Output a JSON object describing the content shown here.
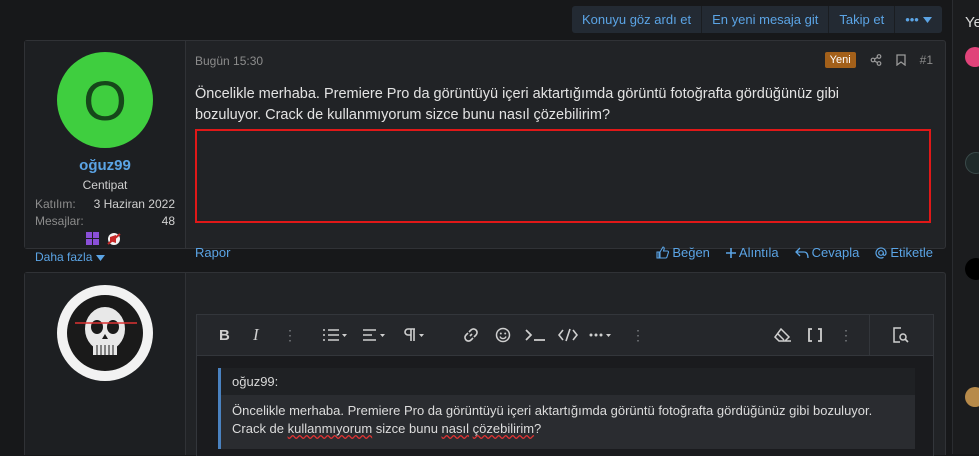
{
  "topbar": {
    "ignore_label": "Konuyu göz ardı et",
    "newest_label": "En yeni mesaja git",
    "follow_label": "Takip et",
    "more_label": "•••"
  },
  "sidebar_right": {
    "title_fragment": "Ye"
  },
  "post": {
    "avatar_letter": "O",
    "username": "oğuz99",
    "user_title": "Centipat",
    "joined_label": "Katılım:",
    "joined_value": "3 Haziran 2022",
    "messages_label": "Mesajlar:",
    "messages_value": "48",
    "more_label": "Daha fazla",
    "time": "Bugün 15:30",
    "new_badge": "Yeni",
    "post_number": "#1",
    "body_line1": "Öncelikle merhaba. Premiere Pro da görüntüyü içeri aktartığımda görüntü fotoğrafta gördüğünüz gibi",
    "body_line2": "bozuluyor. Crack de kullanmıyorum sizce bunu nasıl çözebilirim?",
    "report_label": "Rapor",
    "like_label": "Beğen",
    "quote_label": "Alıntıla",
    "reply_label": "Cevapla",
    "tag_label": "Etiketle"
  },
  "editor": {
    "quote_author": "oğuz99:",
    "quote_line1": "Öncelikle merhaba. Premiere Pro da görüntüyü içeri aktartığımda görüntü fotoğrafta gördüğünüz gibi bozuluyor.",
    "quote_line2_pre": "Crack de ",
    "quote_line2_w1": "kullanmıyorum",
    "quote_line2_mid": " sizce bunu ",
    "quote_line2_w2": "nasıl",
    "quote_line2_w3": "çözebilirim",
    "quote_line2_end": "?"
  },
  "colors": {
    "accent": "#5ba4e5",
    "avatar_bg": "#3fce3f",
    "new_badge": "#a3601a",
    "highlight_box": "#e01818"
  },
  "icons": [
    "share-icon",
    "bookmark-icon",
    "like-icon",
    "plus-icon",
    "reply-icon",
    "at-icon",
    "bold-icon",
    "italic-icon",
    "list-icon",
    "align-icon",
    "paragraph-icon",
    "link-icon",
    "emoji-icon",
    "terminal-icon",
    "code-icon",
    "eraser-icon",
    "brackets-icon",
    "preview-icon",
    "chevron-down-icon"
  ]
}
